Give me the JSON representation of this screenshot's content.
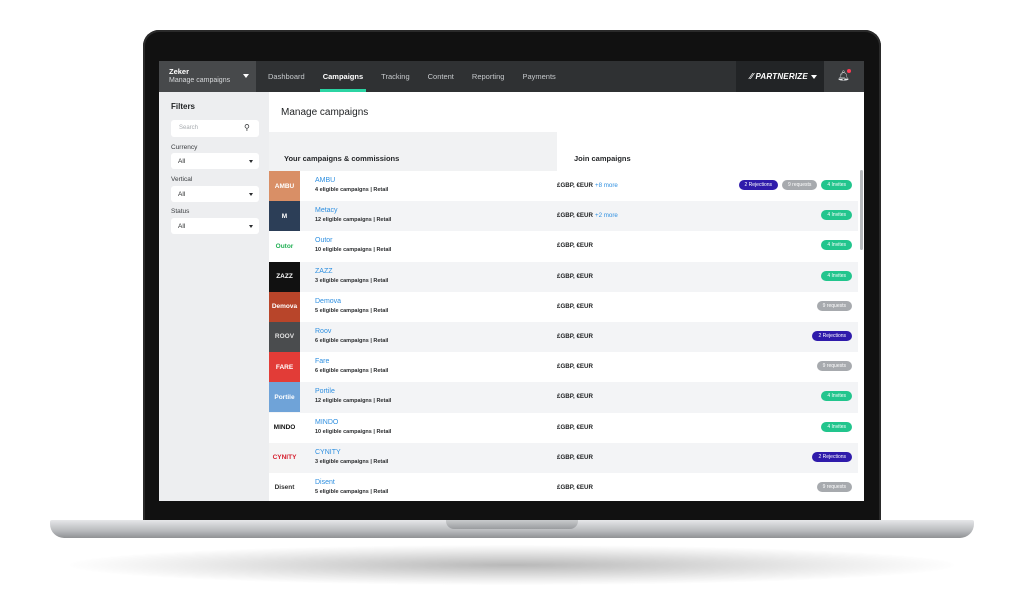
{
  "colors": {
    "accent": "#2bd4a3",
    "link": "#2e8fe0",
    "rejections": "#2f1bab",
    "requests": "#a7aaae",
    "invites": "#22c58d"
  },
  "account": {
    "name": "Zeker",
    "subtitle": "Manage campaigns"
  },
  "nav": [
    "Dashboard",
    "Campaigns",
    "Tracking",
    "Content",
    "Reporting",
    "Payments"
  ],
  "nav_active": "Campaigns",
  "brand": {
    "logo": "⁄⁄ PARTNERIZE"
  },
  "filters": {
    "title": "Filters",
    "search_placeholder": "Search",
    "currency_label": "Currency",
    "currency_value": "All",
    "vertical_label": "Vertical",
    "vertical_value": "All",
    "status_label": "Status",
    "status_value": "All"
  },
  "main": {
    "title": "Manage campaigns",
    "tab_left": "Your campaigns & commissions",
    "tab_right": "Join campaigns"
  },
  "rows": [
    {
      "logo": "AMBU",
      "logo_bg": "#d98f66",
      "logo_fg": "#ffffff",
      "name": "AMBU",
      "meta": "4 eligible campaigns | Retail",
      "currency": "£GBP, €EUR",
      "more": "+8 more",
      "rejections": "2 Rejections",
      "requests": "9 requests",
      "invites": "4 Invites"
    },
    {
      "logo": "M",
      "logo_bg": "#2c3e57",
      "logo_fg": "#ffffff",
      "name": "Metacy",
      "meta": "12 eligible campaigns | Retail",
      "currency": "£GBP, €EUR",
      "more": "+2 more",
      "invites": "4 Invites"
    },
    {
      "logo": "Outor",
      "logo_bg": "#ffffff",
      "logo_fg": "#22b055",
      "name": "Outor",
      "meta": "10 eligible campaigns | Retail",
      "currency": "£GBP, €EUR",
      "invites": "4 Invites"
    },
    {
      "logo": "ZAZZ",
      "logo_bg": "#111111",
      "logo_fg": "#ffffff",
      "name": "ZAZZ",
      "meta": "3 eligible campaigns | Retail",
      "currency": "£GBP, €EUR",
      "invites": "4 Invites"
    },
    {
      "logo": "Demova",
      "logo_bg": "#b8452a",
      "logo_fg": "#ffffff",
      "name": "Demova",
      "meta": "5 eligible campaigns | Retail",
      "currency": "£GBP, €EUR",
      "requests": "9 requests"
    },
    {
      "logo": "ROOV",
      "logo_bg": "#4a4c4e",
      "logo_fg": "#e0e0e0",
      "name": "Roov",
      "meta": "6 eligible campaigns | Retail",
      "currency": "£GBP, €EUR",
      "rejections": "2 Rejections"
    },
    {
      "logo": "FARE",
      "logo_bg": "#e23c37",
      "logo_fg": "#ffffff",
      "name": "Fare",
      "meta": "6 eligible campaigns | Retail",
      "currency": "£GBP, €EUR",
      "requests": "9 requests"
    },
    {
      "logo": "Portile",
      "logo_bg": "#6fa3d8",
      "logo_fg": "#ffffff",
      "name": "Portile",
      "meta": "12 eligible campaigns | Retail",
      "currency": "£GBP, €EUR",
      "invites": "4 Invites"
    },
    {
      "logo": "MINDO",
      "logo_bg": "#ffffff",
      "logo_fg": "#111111",
      "name": "MINDO",
      "meta": "10 eligible campaigns | Retail",
      "currency": "£GBP, €EUR",
      "invites": "4 Invites"
    },
    {
      "logo": "CYNITY",
      "logo_bg": "#f4f4f4",
      "logo_fg": "#d61f2e",
      "name": "CYNITY",
      "meta": "3 eligible campaigns | Retail",
      "currency": "£GBP, €EUR",
      "rejections": "2 Rejections"
    },
    {
      "logo": "Disent",
      "logo_bg": "#ffffff",
      "logo_fg": "#333333",
      "name": "Disent",
      "meta": "5 eligible campaigns | Retail",
      "currency": "£GBP, €EUR",
      "requests": "9 requests"
    }
  ]
}
